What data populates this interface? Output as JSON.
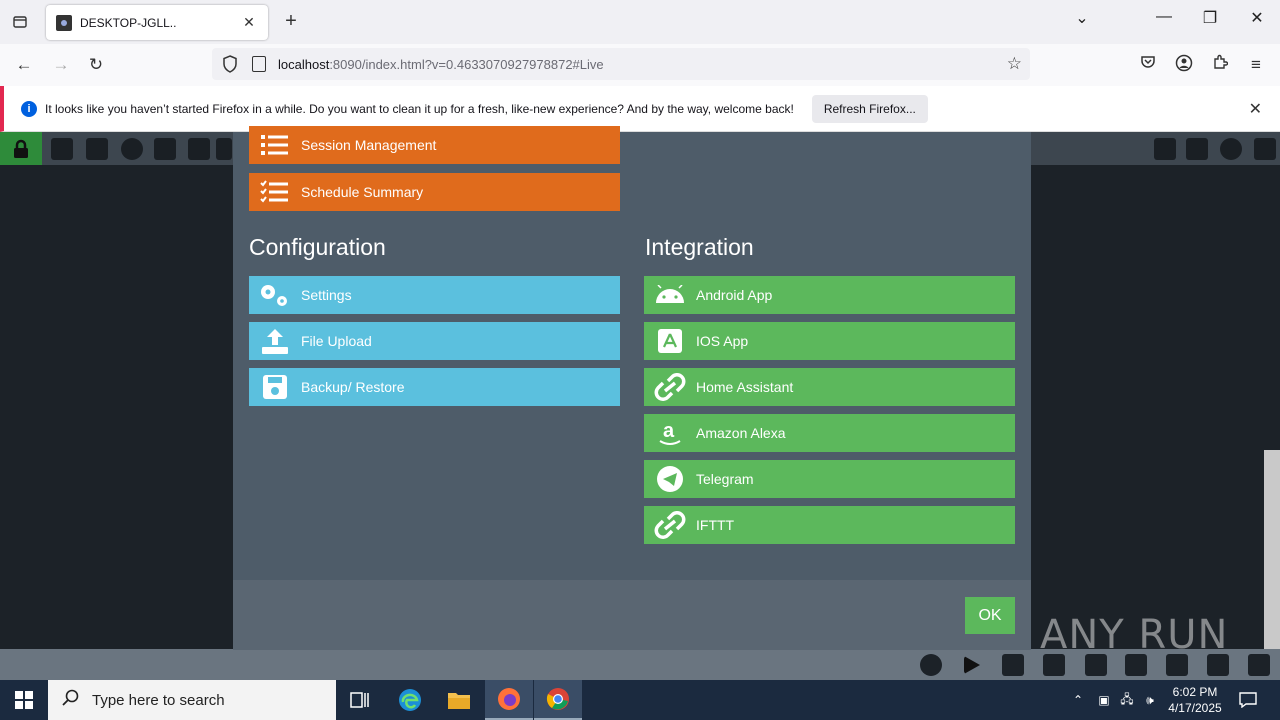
{
  "browser": {
    "tab_title": "DESKTOP-JGLL..",
    "url_host": "localhost",
    "url_rest": ":8090/index.html?v=0.4633070927978872#Live"
  },
  "notification": {
    "text": "It looks like you haven’t started Firefox in a while. Do you want to clean it up for a fresh, like-new experience? And by the way, welcome back!",
    "button": "Refresh Firefox..."
  },
  "modal": {
    "top_items": [
      {
        "label": "Session Management",
        "icon": "list-icon"
      },
      {
        "label": "Schedule Summary",
        "icon": "checklist-icon"
      }
    ],
    "configuration": {
      "title": "Configuration",
      "items": [
        {
          "label": "Settings",
          "icon": "gears-icon"
        },
        {
          "label": "File Upload",
          "icon": "upload-icon"
        },
        {
          "label": "Backup/ Restore",
          "icon": "floppy-icon"
        }
      ]
    },
    "integration": {
      "title": "Integration",
      "items": [
        {
          "label": "Android App",
          "icon": "android-icon"
        },
        {
          "label": "IOS App",
          "icon": "app-store-icon"
        },
        {
          "label": "Home Assistant",
          "icon": "link-icon"
        },
        {
          "label": "Amazon Alexa",
          "icon": "amazon-icon"
        },
        {
          "label": "Telegram",
          "icon": "telegram-icon"
        },
        {
          "label": "IFTTT",
          "icon": "link-icon"
        }
      ]
    },
    "ok": "OK"
  },
  "watermark": "ANY RUN",
  "taskbar": {
    "search_placeholder": "Type here to search",
    "time": "6:02 PM",
    "date": "4/17/2025"
  }
}
